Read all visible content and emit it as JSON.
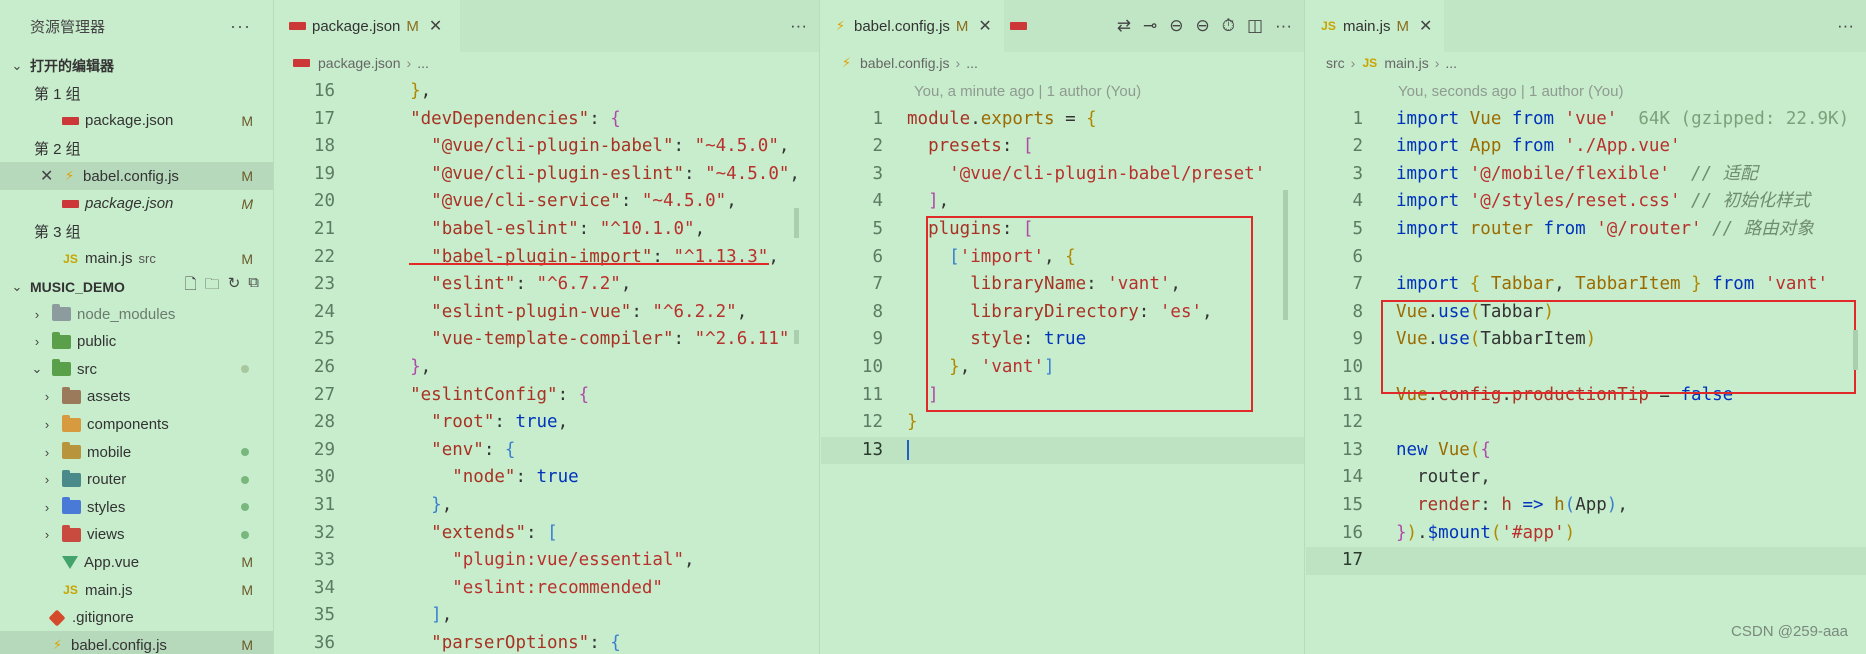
{
  "sidebar": {
    "title": "资源管理器",
    "more": "···",
    "open_editors": {
      "title": "打开的编辑器",
      "groups": [
        {
          "label": "第 1 组",
          "files": [
            {
              "name": "package.json",
              "status": "M"
            }
          ]
        },
        {
          "label": "第 2 组",
          "files": [
            {
              "name": "babel.config.js",
              "status": "M"
            },
            {
              "name": "package.json",
              "status": "M"
            }
          ]
        },
        {
          "label": "第 3 组",
          "files": [
            {
              "name": "main.js",
              "path": "src",
              "status": "M"
            }
          ]
        }
      ]
    },
    "project": {
      "title": "MUSIC_DEMO",
      "tree": [
        {
          "name": "node_modules"
        },
        {
          "name": "public"
        },
        {
          "name": "src"
        },
        {
          "name": "assets"
        },
        {
          "name": "components"
        },
        {
          "name": "mobile"
        },
        {
          "name": "router"
        },
        {
          "name": "styles"
        },
        {
          "name": "views"
        },
        {
          "name": "App.vue",
          "status": "M"
        },
        {
          "name": "main.js",
          "status": "M"
        },
        {
          "name": ".gitignore"
        },
        {
          "name": "babel.config.js",
          "status": "M"
        }
      ]
    }
  },
  "group1": {
    "tab": {
      "name": "package.json",
      "status": "M"
    },
    "more": "···",
    "breadcrumb": [
      "package.json",
      "..."
    ],
    "lines": [
      {
        "n": "16",
        "t": "  },"
      },
      {
        "n": "17",
        "t": "  \"devDependencies\": {"
      },
      {
        "n": "18",
        "t": "    \"@vue/cli-plugin-babel\": \"~4.5.0\","
      },
      {
        "n": "19",
        "t": "    \"@vue/cli-plugin-eslint\": \"~4.5.0\","
      },
      {
        "n": "20",
        "t": "    \"@vue/cli-service\": \"~4.5.0\","
      },
      {
        "n": "21",
        "t": "    \"babel-eslint\": \"^10.1.0\","
      },
      {
        "n": "22",
        "t": "    \"babel-plugin-import\": \"^1.13.3\","
      },
      {
        "n": "23",
        "t": "    \"eslint\": \"^6.7.2\","
      },
      {
        "n": "24",
        "t": "    \"eslint-plugin-vue\": \"^6.2.2\","
      },
      {
        "n": "25",
        "t": "    \"vue-template-compiler\": \"^2.6.11\""
      },
      {
        "n": "26",
        "t": "  },"
      },
      {
        "n": "27",
        "t": "  \"eslintConfig\": {"
      },
      {
        "n": "28",
        "t": "    \"root\": true,"
      },
      {
        "n": "29",
        "t": "    \"env\": {"
      },
      {
        "n": "30",
        "t": "      \"node\": true"
      },
      {
        "n": "31",
        "t": "    },"
      },
      {
        "n": "32",
        "t": "    \"extends\": ["
      },
      {
        "n": "33",
        "t": "      \"plugin:vue/essential\","
      },
      {
        "n": "34",
        "t": "      \"eslint:recommended\""
      },
      {
        "n": "35",
        "t": "    ],"
      },
      {
        "n": "36",
        "t": "    \"parserOptions\": {"
      }
    ]
  },
  "group2": {
    "tab": {
      "name": "babel.config.js",
      "status": "M"
    },
    "more": "···",
    "breadcrumb": [
      "babel.config.js",
      "..."
    ],
    "blame": "You, a minute ago | 1 author (You)",
    "lines": [
      {
        "n": "1",
        "t": "module.exports = {"
      },
      {
        "n": "2",
        "t": "  presets: ["
      },
      {
        "n": "3",
        "t": "    '@vue/cli-plugin-babel/preset'"
      },
      {
        "n": "4",
        "t": "  ],"
      },
      {
        "n": "5",
        "t": "  plugins: ["
      },
      {
        "n": "6",
        "t": "    ['import', {"
      },
      {
        "n": "7",
        "t": "      libraryName: 'vant',"
      },
      {
        "n": "8",
        "t": "      libraryDirectory: 'es',"
      },
      {
        "n": "9",
        "t": "      style: true"
      },
      {
        "n": "10",
        "t": "    }, 'vant']"
      },
      {
        "n": "11",
        "t": "  ]"
      },
      {
        "n": "12",
        "t": "}"
      },
      {
        "n": "13",
        "t": ""
      }
    ]
  },
  "group3": {
    "tab": {
      "name": "main.js",
      "status": "M"
    },
    "more": "···",
    "breadcrumb": [
      "src",
      "main.js",
      "..."
    ],
    "blame": "You, seconds ago | 1 author (You)",
    "import_size": "64K (gzipped: 22.9K)",
    "lines": [
      {
        "n": "1",
        "t": "import Vue from 'vue'"
      },
      {
        "n": "2",
        "t": "import App from './App.vue'"
      },
      {
        "n": "3",
        "t": "import '@/mobile/flexible'  // 适配"
      },
      {
        "n": "4",
        "t": "import '@/styles/reset.css' // 初始化样式"
      },
      {
        "n": "5",
        "t": "import router from '@/router' // 路由对象"
      },
      {
        "n": "6",
        "t": ""
      },
      {
        "n": "7",
        "t": "import { Tabbar, TabbarItem } from 'vant'"
      },
      {
        "n": "8",
        "t": "Vue.use(Tabbar)"
      },
      {
        "n": "9",
        "t": "Vue.use(TabbarItem)"
      },
      {
        "n": "10",
        "t": ""
      },
      {
        "n": "11",
        "t": "Vue.config.productionTip = false"
      },
      {
        "n": "12",
        "t": ""
      },
      {
        "n": "13",
        "t": "new Vue({"
      },
      {
        "n": "14",
        "t": "  router,"
      },
      {
        "n": "15",
        "t": "  render: h => h(App),"
      },
      {
        "n": "16",
        "t": "}).$mount('#app')"
      },
      {
        "n": "17",
        "t": ""
      }
    ]
  },
  "watermark": "CSDN @259-aaa"
}
